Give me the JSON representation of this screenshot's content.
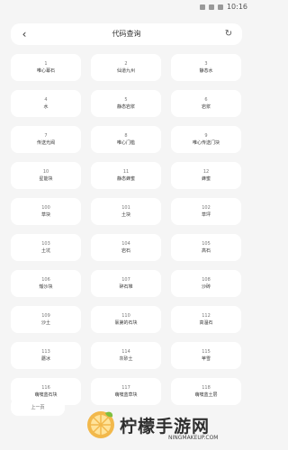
{
  "status_bar": {
    "time": "10:16"
  },
  "header": {
    "title": "代码查询"
  },
  "items": [
    {
      "code": "1",
      "name": "唯心幕石"
    },
    {
      "code": "2",
      "name": "仙道九州"
    },
    {
      "code": "3",
      "name": "静态水"
    },
    {
      "code": "4",
      "name": "水"
    },
    {
      "code": "5",
      "name": "静态岩浆"
    },
    {
      "code": "6",
      "name": "岩浆"
    },
    {
      "code": "7",
      "name": "传送光阀"
    },
    {
      "code": "8",
      "name": "唯心门槛"
    },
    {
      "code": "9",
      "name": "唯心传送门块"
    },
    {
      "code": "10",
      "name": "星能块"
    },
    {
      "code": "11",
      "name": "静态蜂蜜"
    },
    {
      "code": "12",
      "name": "蜂蜜"
    },
    {
      "code": "100",
      "name": "草块"
    },
    {
      "code": "101",
      "name": "土块"
    },
    {
      "code": "102",
      "name": "草坪"
    },
    {
      "code": "103",
      "name": "土坑"
    },
    {
      "code": "104",
      "name": "岩石"
    },
    {
      "code": "105",
      "name": "高石"
    },
    {
      "code": "106",
      "name": "矮沙块"
    },
    {
      "code": "107",
      "name": "碎石堆"
    },
    {
      "code": "108",
      "name": "沙砖"
    },
    {
      "code": "109",
      "name": "沙土"
    },
    {
      "code": "110",
      "name": "氯第的石块"
    },
    {
      "code": "112",
      "name": "高温石"
    },
    {
      "code": "113",
      "name": "蘑冰"
    },
    {
      "code": "114",
      "name": "灰砂土"
    },
    {
      "code": "115",
      "name": "苹雪"
    },
    {
      "code": "116",
      "name": "萌噢蓝石块"
    },
    {
      "code": "117",
      "name": "萌噢蓝草块"
    },
    {
      "code": "118",
      "name": "萌噢蓝土层"
    }
  ],
  "pagination": {
    "prev_label": "上一页"
  },
  "watermark": {
    "title": "柠檬手游网",
    "subtitle": "NINGMAKEUP.COM"
  }
}
